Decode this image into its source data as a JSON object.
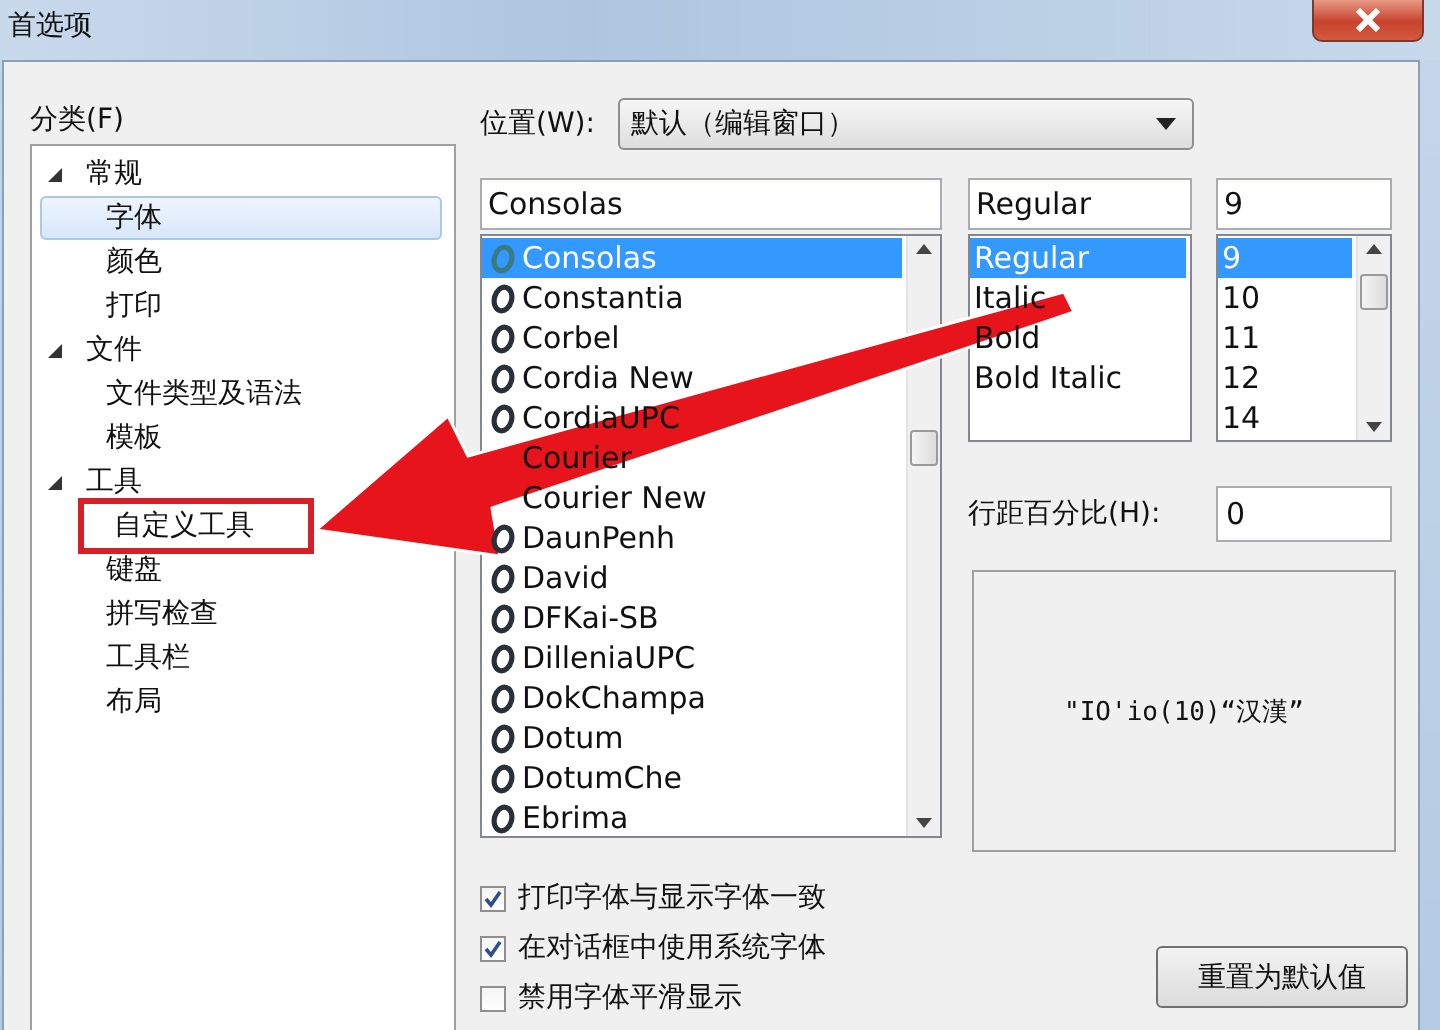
{
  "window": {
    "title": "首选项"
  },
  "category": {
    "label": "分类(F)",
    "tree": [
      {
        "label": "常规",
        "expanded": true,
        "selected": false,
        "marked": false,
        "children": [
          {
            "label": "字体",
            "selected": true,
            "marked": false
          },
          {
            "label": "颜色",
            "selected": false,
            "marked": false
          },
          {
            "label": "打印",
            "selected": false,
            "marked": false
          }
        ]
      },
      {
        "label": "文件",
        "expanded": true,
        "selected": false,
        "marked": false,
        "children": [
          {
            "label": "文件类型及语法",
            "selected": false,
            "marked": false
          },
          {
            "label": "模板",
            "selected": false,
            "marked": false
          }
        ]
      },
      {
        "label": "工具",
        "expanded": true,
        "selected": false,
        "marked": false,
        "children": [
          {
            "label": "自定义工具",
            "selected": false,
            "marked": true
          },
          {
            "label": "键盘",
            "selected": false,
            "marked": false
          },
          {
            "label": "拼写检查",
            "selected": false,
            "marked": false
          },
          {
            "label": "工具栏",
            "selected": false,
            "marked": false
          },
          {
            "label": "布局",
            "selected": false,
            "marked": false
          }
        ]
      }
    ]
  },
  "position": {
    "label": "位置(W):",
    "value": "默认（编辑窗口）"
  },
  "font": {
    "value": "Consolas",
    "items": [
      {
        "label": "Consolas",
        "kind": "opentype",
        "selected": true
      },
      {
        "label": "Constantia",
        "kind": "opentype",
        "selected": false
      },
      {
        "label": "Corbel",
        "kind": "opentype",
        "selected": false
      },
      {
        "label": "Cordia New",
        "kind": "opentype",
        "selected": false
      },
      {
        "label": "CordiaUPC",
        "kind": "opentype",
        "selected": false
      },
      {
        "label": "Courier",
        "kind": "plain",
        "selected": false
      },
      {
        "label": "Courier New",
        "kind": "plain",
        "selected": false
      },
      {
        "label": "DaunPenh",
        "kind": "opentype",
        "selected": false
      },
      {
        "label": "David",
        "kind": "opentype",
        "selected": false
      },
      {
        "label": "DFKai-SB",
        "kind": "opentype",
        "selected": false
      },
      {
        "label": "DilleniaUPC",
        "kind": "opentype",
        "selected": false
      },
      {
        "label": "DokChampa",
        "kind": "opentype",
        "selected": false
      },
      {
        "label": "Dotum",
        "kind": "opentype",
        "selected": false
      },
      {
        "label": "DotumChe",
        "kind": "opentype",
        "selected": false
      },
      {
        "label": "Ebrima",
        "kind": "opentype",
        "selected": false
      }
    ]
  },
  "style": {
    "value": "Regular",
    "items": [
      {
        "label": "Regular",
        "selected": true
      },
      {
        "label": "Italic",
        "selected": false
      },
      {
        "label": "Bold",
        "selected": false
      },
      {
        "label": "Bold Italic",
        "selected": false
      }
    ]
  },
  "size": {
    "value": "9",
    "items": [
      {
        "label": "9",
        "selected": true
      },
      {
        "label": "10",
        "selected": false
      },
      {
        "label": "11",
        "selected": false
      },
      {
        "label": "12",
        "selected": false
      },
      {
        "label": "14",
        "selected": false
      }
    ]
  },
  "line_spacing": {
    "label": "行距百分比(H):",
    "value": "0"
  },
  "preview": {
    "text": "\"IO'io(10)“汉漢”"
  },
  "options": [
    {
      "label": "打印字体与显示字体一致",
      "checked": true
    },
    {
      "label": "在对话框中使用系统字体",
      "checked": true
    },
    {
      "label": "禁用字体平滑显示",
      "checked": false
    }
  ],
  "reset_button": "重置为默认值"
}
